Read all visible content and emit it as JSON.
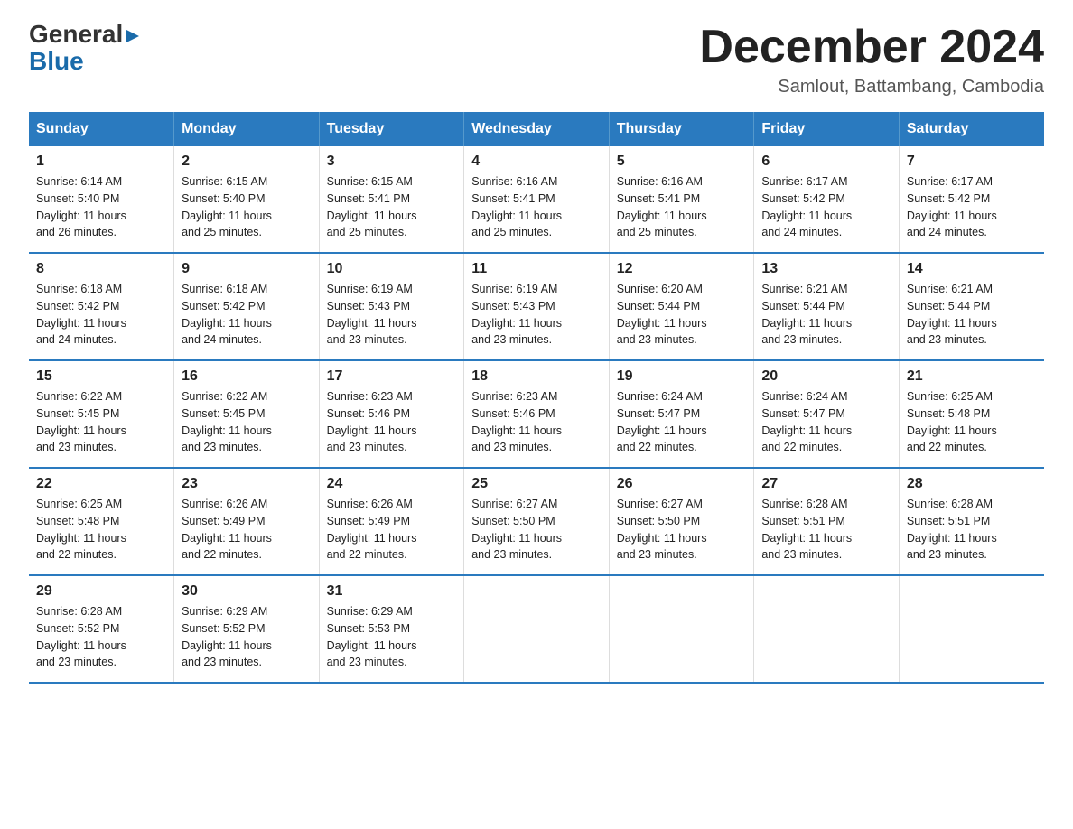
{
  "logo": {
    "general": "General",
    "blue": "Blue"
  },
  "title": "December 2024",
  "location": "Samlout, Battambang, Cambodia",
  "headers": [
    "Sunday",
    "Monday",
    "Tuesday",
    "Wednesday",
    "Thursday",
    "Friday",
    "Saturday"
  ],
  "weeks": [
    [
      {
        "day": "1",
        "sunrise": "6:14 AM",
        "sunset": "5:40 PM",
        "daylight": "11 hours and 26 minutes."
      },
      {
        "day": "2",
        "sunrise": "6:15 AM",
        "sunset": "5:40 PM",
        "daylight": "11 hours and 25 minutes."
      },
      {
        "day": "3",
        "sunrise": "6:15 AM",
        "sunset": "5:41 PM",
        "daylight": "11 hours and 25 minutes."
      },
      {
        "day": "4",
        "sunrise": "6:16 AM",
        "sunset": "5:41 PM",
        "daylight": "11 hours and 25 minutes."
      },
      {
        "day": "5",
        "sunrise": "6:16 AM",
        "sunset": "5:41 PM",
        "daylight": "11 hours and 25 minutes."
      },
      {
        "day": "6",
        "sunrise": "6:17 AM",
        "sunset": "5:42 PM",
        "daylight": "11 hours and 24 minutes."
      },
      {
        "day": "7",
        "sunrise": "6:17 AM",
        "sunset": "5:42 PM",
        "daylight": "11 hours and 24 minutes."
      }
    ],
    [
      {
        "day": "8",
        "sunrise": "6:18 AM",
        "sunset": "5:42 PM",
        "daylight": "11 hours and 24 minutes."
      },
      {
        "day": "9",
        "sunrise": "6:18 AM",
        "sunset": "5:42 PM",
        "daylight": "11 hours and 24 minutes."
      },
      {
        "day": "10",
        "sunrise": "6:19 AM",
        "sunset": "5:43 PM",
        "daylight": "11 hours and 23 minutes."
      },
      {
        "day": "11",
        "sunrise": "6:19 AM",
        "sunset": "5:43 PM",
        "daylight": "11 hours and 23 minutes."
      },
      {
        "day": "12",
        "sunrise": "6:20 AM",
        "sunset": "5:44 PM",
        "daylight": "11 hours and 23 minutes."
      },
      {
        "day": "13",
        "sunrise": "6:21 AM",
        "sunset": "5:44 PM",
        "daylight": "11 hours and 23 minutes."
      },
      {
        "day": "14",
        "sunrise": "6:21 AM",
        "sunset": "5:44 PM",
        "daylight": "11 hours and 23 minutes."
      }
    ],
    [
      {
        "day": "15",
        "sunrise": "6:22 AM",
        "sunset": "5:45 PM",
        "daylight": "11 hours and 23 minutes."
      },
      {
        "day": "16",
        "sunrise": "6:22 AM",
        "sunset": "5:45 PM",
        "daylight": "11 hours and 23 minutes."
      },
      {
        "day": "17",
        "sunrise": "6:23 AM",
        "sunset": "5:46 PM",
        "daylight": "11 hours and 23 minutes."
      },
      {
        "day": "18",
        "sunrise": "6:23 AM",
        "sunset": "5:46 PM",
        "daylight": "11 hours and 23 minutes."
      },
      {
        "day": "19",
        "sunrise": "6:24 AM",
        "sunset": "5:47 PM",
        "daylight": "11 hours and 22 minutes."
      },
      {
        "day": "20",
        "sunrise": "6:24 AM",
        "sunset": "5:47 PM",
        "daylight": "11 hours and 22 minutes."
      },
      {
        "day": "21",
        "sunrise": "6:25 AM",
        "sunset": "5:48 PM",
        "daylight": "11 hours and 22 minutes."
      }
    ],
    [
      {
        "day": "22",
        "sunrise": "6:25 AM",
        "sunset": "5:48 PM",
        "daylight": "11 hours and 22 minutes."
      },
      {
        "day": "23",
        "sunrise": "6:26 AM",
        "sunset": "5:49 PM",
        "daylight": "11 hours and 22 minutes."
      },
      {
        "day": "24",
        "sunrise": "6:26 AM",
        "sunset": "5:49 PM",
        "daylight": "11 hours and 22 minutes."
      },
      {
        "day": "25",
        "sunrise": "6:27 AM",
        "sunset": "5:50 PM",
        "daylight": "11 hours and 23 minutes."
      },
      {
        "day": "26",
        "sunrise": "6:27 AM",
        "sunset": "5:50 PM",
        "daylight": "11 hours and 23 minutes."
      },
      {
        "day": "27",
        "sunrise": "6:28 AM",
        "sunset": "5:51 PM",
        "daylight": "11 hours and 23 minutes."
      },
      {
        "day": "28",
        "sunrise": "6:28 AM",
        "sunset": "5:51 PM",
        "daylight": "11 hours and 23 minutes."
      }
    ],
    [
      {
        "day": "29",
        "sunrise": "6:28 AM",
        "sunset": "5:52 PM",
        "daylight": "11 hours and 23 minutes."
      },
      {
        "day": "30",
        "sunrise": "6:29 AM",
        "sunset": "5:52 PM",
        "daylight": "11 hours and 23 minutes."
      },
      {
        "day": "31",
        "sunrise": "6:29 AM",
        "sunset": "5:53 PM",
        "daylight": "11 hours and 23 minutes."
      },
      null,
      null,
      null,
      null
    ]
  ],
  "labels": {
    "sunrise": "Sunrise:",
    "sunset": "Sunset:",
    "daylight": "Daylight:"
  }
}
